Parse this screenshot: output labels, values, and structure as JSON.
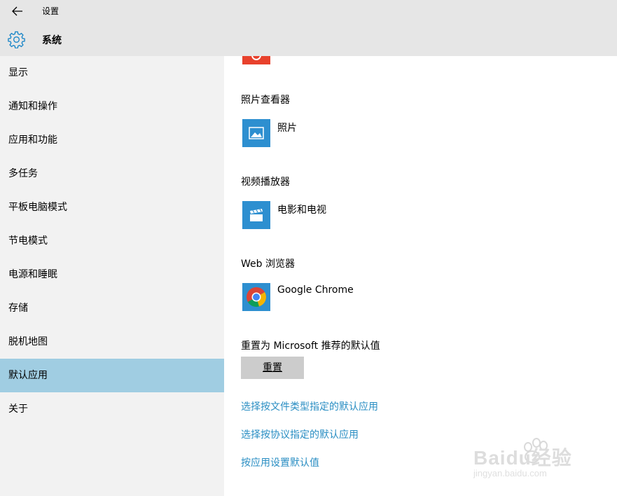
{
  "window": {
    "title": "设置",
    "back_icon": "arrow-left-icon"
  },
  "header": {
    "title": "系统",
    "icon": "gear-icon",
    "icon_color": "#1a86c8"
  },
  "sidebar": {
    "items": [
      {
        "label": "显示"
      },
      {
        "label": "通知和操作"
      },
      {
        "label": "应用和功能"
      },
      {
        "label": "多任务"
      },
      {
        "label": "平板电脑模式"
      },
      {
        "label": "节电模式"
      },
      {
        "label": "电源和睡眠"
      },
      {
        "label": "存储"
      },
      {
        "label": "脱机地图"
      },
      {
        "label": "默认应用",
        "selected": true
      },
      {
        "label": "关于"
      }
    ],
    "selected_color": "#a0cde2"
  },
  "main": {
    "photo_viewer": {
      "label": "照片查看器",
      "app_name": "照片",
      "icon": "photos-icon"
    },
    "video_player": {
      "label": "视频播放器",
      "app_name": "电影和电视",
      "icon": "clapperboard-icon"
    },
    "web_browser": {
      "label": "Web 浏览器",
      "app_name": "Google Chrome",
      "icon": "chrome-icon"
    },
    "reset": {
      "label": "重置为 Microsoft 推荐的默认值",
      "button": "重置"
    },
    "links": [
      {
        "label": "选择按文件类型指定的默认应用"
      },
      {
        "label": "选择按协议指定的默认应用"
      },
      {
        "label": "按应用设置默认值"
      }
    ],
    "accent_color": "#2a8ec3",
    "tile_color": "#2d8fd0"
  },
  "watermark": {
    "brand": "Baidu经验",
    "url": "jingyan.baidu.com"
  }
}
